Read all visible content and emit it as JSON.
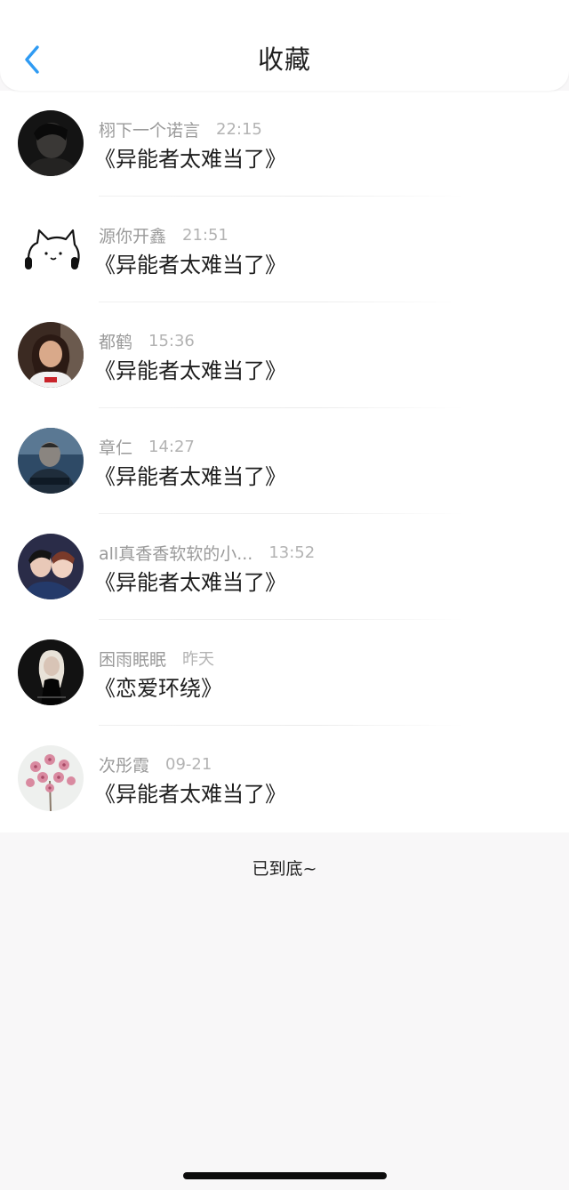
{
  "header": {
    "title": "收藏",
    "back_icon": "chevron-left-icon",
    "accent_color": "#2f9bf3"
  },
  "favorites": [
    {
      "user": "栩下一个诺言",
      "time": "22:15",
      "book": "《异能者太难当了》",
      "avatar": "dark-portrait-avatar"
    },
    {
      "user": "源你开鑫",
      "time": "21:51",
      "book": "《异能者太难当了》",
      "avatar": "cartoon-cat-headphones-avatar"
    },
    {
      "user": "都鹤",
      "time": "15:36",
      "book": "《异能者太难当了》",
      "avatar": "girl-portrait-avatar"
    },
    {
      "user": "章仁",
      "time": "14:27",
      "book": "《异能者太难当了》",
      "avatar": "man-at-laptop-avatar"
    },
    {
      "user": "all真香香软软的小...",
      "time": "13:52",
      "book": "《异能者太难当了》",
      "avatar": "couple-portrait-avatar"
    },
    {
      "user": "困雨眠眠",
      "time": "昨天",
      "book": "《恋爱环绕》",
      "avatar": "blonde-woman-avatar"
    },
    {
      "user": "次彤霞",
      "time": "09-21",
      "book": "《异能者太难当了》",
      "avatar": "pink-flowers-avatar"
    }
  ],
  "footer": {
    "end_text": "已到底~"
  }
}
